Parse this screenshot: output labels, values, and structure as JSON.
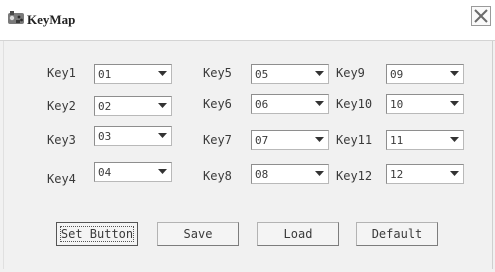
{
  "window": {
    "title": "KeyMap",
    "app_icon": "joystick-icon",
    "close_icon": "close-icon"
  },
  "keys": [
    {
      "label": "Key1",
      "value": "01"
    },
    {
      "label": "Key2",
      "value": "02"
    },
    {
      "label": "Key3",
      "value": "03"
    },
    {
      "label": "Key4",
      "value": "04"
    },
    {
      "label": "Key5",
      "value": "05"
    },
    {
      "label": "Key6",
      "value": "06"
    },
    {
      "label": "Key7",
      "value": "07"
    },
    {
      "label": "Key8",
      "value": "08"
    },
    {
      "label": "Key9",
      "value": "09"
    },
    {
      "label": "Key10",
      "value": "10"
    },
    {
      "label": "Key11",
      "value": "11"
    },
    {
      "label": "Key12",
      "value": "12"
    }
  ],
  "buttons": {
    "set_button": "Set Button",
    "save": "Save",
    "load": "Load",
    "default": "Default"
  }
}
